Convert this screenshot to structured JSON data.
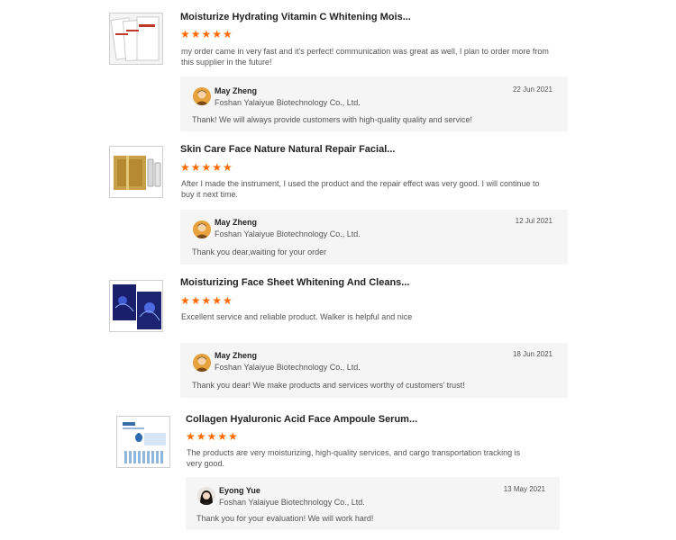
{
  "reviews": [
    {
      "product_title": "Moisturize Hydrating Vitamin C Whitening Mois...",
      "rating": 5,
      "stars": "★★★★★",
      "text": "my order came in very fast and it's perfect! communication was great as well, I plan to order more from this supplier in the future!",
      "reply": {
        "name": "May Zheng",
        "company": "Foshan Yalaiyue Biotechnology Co., Ltd.",
        "date": "22 Jun 2021",
        "message": "Thank! We will always provide customers with high-quality quality and service!"
      }
    },
    {
      "product_title": "Skin Care Face Nature Natural  Repair Facial...",
      "rating": 5,
      "stars": "★★★★★",
      "text": "After I made the instrument, I used the product and the repair effect was very good. I will continue to buy it next time.",
      "reply": {
        "name": "May Zheng",
        "company": "Foshan Yalaiyue Biotechnology Co., Ltd.",
        "date": "12 Jul 2021",
        "message": "Thank you dear,waiting for your order"
      }
    },
    {
      "product_title": "Moisturizing Face Sheet Whitening And Cleans...",
      "rating": 5,
      "stars": "★★★★★",
      "text": "Excellent service and reliable product. Walker is helpful and nice",
      "reply": {
        "name": "May Zheng",
        "company": "Foshan Yalaiyue Biotechnology Co., Ltd.",
        "date": "18 Jun 2021",
        "message": "Thank you dear! We make products and services worthy of customers' trust!"
      }
    },
    {
      "product_title": "Collagen Hyaluronic Acid Face Ampoule Serum...",
      "rating": 5,
      "stars": "★★★★★",
      "text": "The products are very moisturizing, high-quality services, and cargo transportation tracking is very good.",
      "reply": {
        "name": "Eyong Yue",
        "company": "Foshan Yalaiyue Biotechnology Co., Ltd.",
        "date": "13 May 2021",
        "message": "Thank you for your evaluation! We will work hard!"
      }
    }
  ],
  "colors": {
    "star": "#ff6a00",
    "reply_bg": "#f5f5f5"
  }
}
